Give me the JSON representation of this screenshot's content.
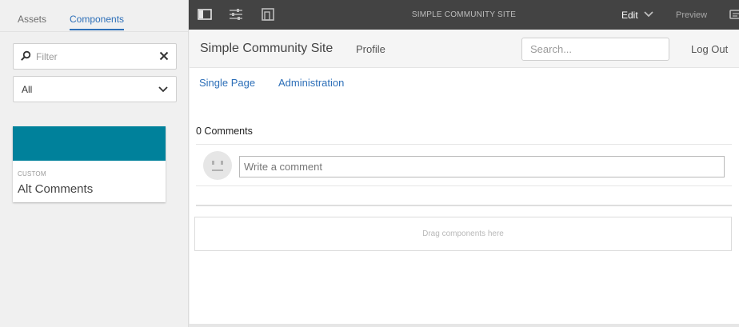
{
  "rail": {
    "tabs": [
      {
        "label": "Assets",
        "active": false
      },
      {
        "label": "Components",
        "active": true
      }
    ],
    "filter": {
      "placeholder": "Filter",
      "value": ""
    },
    "group_select": {
      "value": "All"
    },
    "components": [
      {
        "group": "CUSTOM",
        "name": "Alt Comments",
        "color": "#00819b"
      }
    ]
  },
  "toolbar": {
    "title": "SIMPLE COMMUNITY SITE",
    "edit_label": "Edit",
    "preview_label": "Preview",
    "icons": [
      "side-panel-icon",
      "properties-icon",
      "emulator-icon",
      "annotations-icon"
    ]
  },
  "site": {
    "name": "Simple Community Site",
    "profile_label": "Profile",
    "search_placeholder": "Search...",
    "logout_label": "Log Out",
    "nav": [
      "Single Page",
      "Administration"
    ],
    "comments_count_label": "0 Comments",
    "comment_placeholder": "Write a comment",
    "dropzone_label": "Drag components here"
  },
  "colors": {
    "accent": "#2d6fb8",
    "toolbar_bg": "#434343",
    "component_swatch": "#00819b"
  }
}
